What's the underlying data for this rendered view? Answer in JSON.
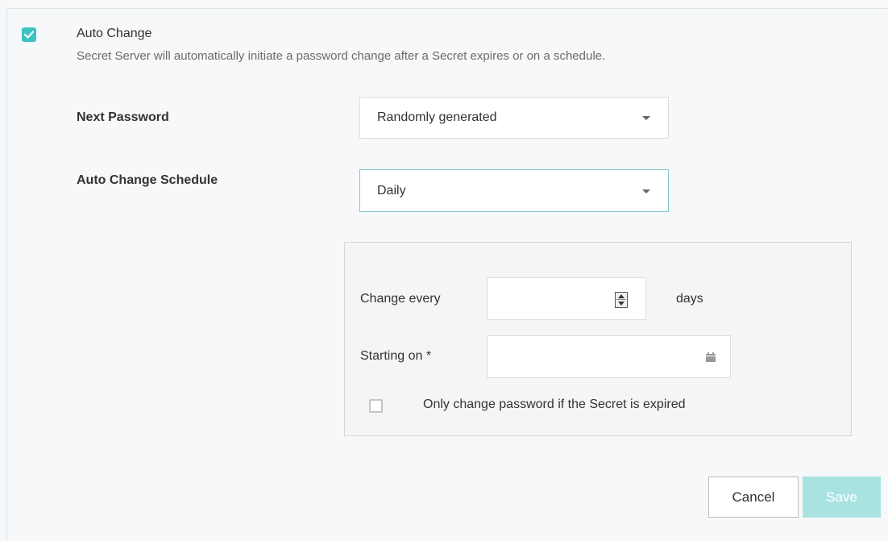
{
  "auto_change": {
    "checked": true,
    "title": "Auto Change",
    "description": "Secret Server will automatically initiate a password change after a Secret expires or on a schedule."
  },
  "next_password": {
    "label": "Next Password",
    "value": "Randomly generated"
  },
  "schedule": {
    "label": "Auto Change Schedule",
    "value": "Daily"
  },
  "daily_options": {
    "change_every_label": "Change every",
    "change_every_value": "",
    "days_label": "days",
    "starting_on_label": "Starting on *",
    "starting_on_value": "",
    "only_if_expired_label": "Only change password if the Secret is expired",
    "only_if_expired_checked": false
  },
  "buttons": {
    "cancel": "Cancel",
    "save": "Save"
  },
  "colors": {
    "accent": "#3cc2c0",
    "save_disabled": "#a8e3e1",
    "focus_border": "#7fc6cf"
  }
}
